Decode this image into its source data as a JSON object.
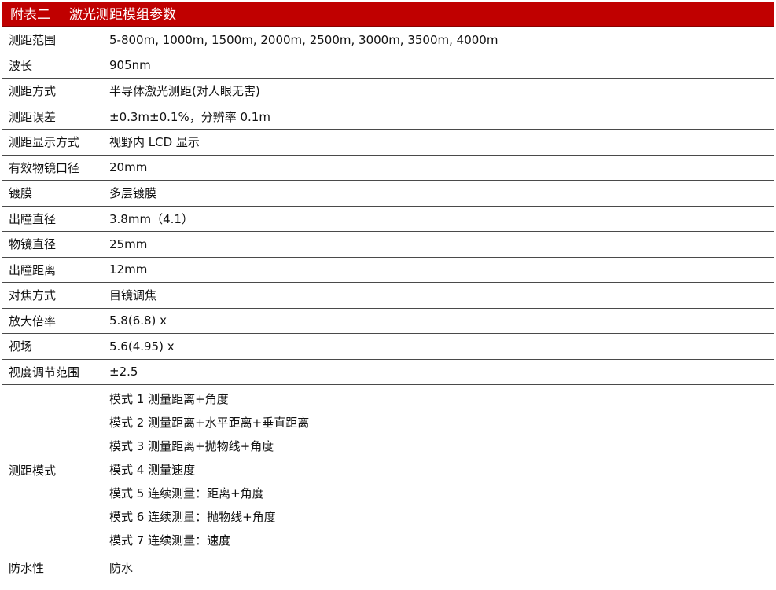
{
  "title": {
    "label": "附表二",
    "text": "激光测距模组参数"
  },
  "specs": [
    {
      "key": "测距范围",
      "value": "5-800m, 1000m, 1500m, 2000m, 2500m, 3000m, 3500m, 4000m"
    },
    {
      "key": "波长",
      "value": "905nm"
    },
    {
      "key": "测距方式",
      "value": "半导体激光测距(对人眼无害)"
    },
    {
      "key": "测距误差",
      "value": "±0.3m±0.1%，分辨率 0.1m"
    },
    {
      "key": "测距显示方式",
      "value": "视野内 LCD 显示"
    },
    {
      "key": "有效物镜口径",
      "value": "20mm"
    },
    {
      "key": "镀膜",
      "value": "多层镀膜"
    },
    {
      "key": "出瞳直径",
      "value": "3.8mm（4.1）"
    },
    {
      "key": "物镜直径",
      "value": "25mm"
    },
    {
      "key": "出瞳距离",
      "value": "12mm"
    },
    {
      "key": "对焦方式",
      "value": "目镜调焦"
    },
    {
      "key": "放大倍率",
      "value": "5.8(6.8) x"
    },
    {
      "key": "视场",
      "value": "5.6(4.95) x"
    },
    {
      "key": "视度调节范围",
      "value": "±2.5"
    }
  ],
  "modes": {
    "key": "测距模式",
    "lines": [
      "模式 1  测量距离+角度",
      "模式 2  测量距离+水平距离+垂直距离",
      "模式 3  测量距离+抛物线+角度",
      "模式 4  测量速度",
      "模式 5  连续测量：距离+角度",
      "模式 6  连续测量：抛物线+角度",
      "模式 7  连续测量：速度"
    ]
  },
  "last": {
    "key": "防水性",
    "value": "防水"
  }
}
